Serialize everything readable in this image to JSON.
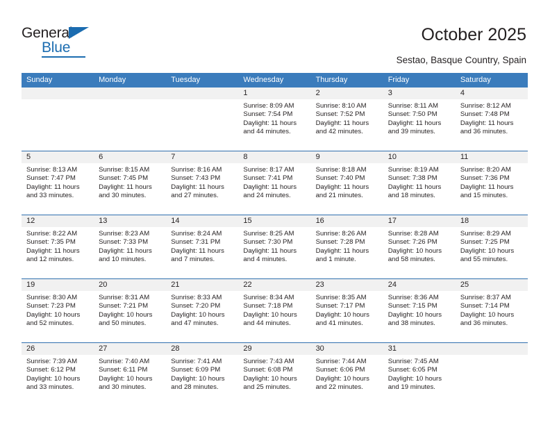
{
  "brand": {
    "name_part1": "General",
    "name_part2": "Blue",
    "accent_color": "#1b6cb0"
  },
  "header": {
    "title": "October 2025",
    "subtitle": "Sestao, Basque Country, Spain"
  },
  "calendar": {
    "header_bg": "#3b7cbc",
    "weekdays": [
      "Sunday",
      "Monday",
      "Tuesday",
      "Wednesday",
      "Thursday",
      "Friday",
      "Saturday"
    ],
    "labels": {
      "sunrise": "Sunrise:",
      "sunset": "Sunset:",
      "daylight": "Daylight:"
    },
    "weeks": [
      [
        {
          "day": "",
          "sunrise": "",
          "sunset": "",
          "daylight": "",
          "empty": true
        },
        {
          "day": "",
          "sunrise": "",
          "sunset": "",
          "daylight": "",
          "empty": true
        },
        {
          "day": "",
          "sunrise": "",
          "sunset": "",
          "daylight": "",
          "empty": true
        },
        {
          "day": "1",
          "sunrise": "Sunrise: 8:09 AM",
          "sunset": "Sunset: 7:54 PM",
          "daylight": "Daylight: 11 hours and 44 minutes."
        },
        {
          "day": "2",
          "sunrise": "Sunrise: 8:10 AM",
          "sunset": "Sunset: 7:52 PM",
          "daylight": "Daylight: 11 hours and 42 minutes."
        },
        {
          "day": "3",
          "sunrise": "Sunrise: 8:11 AM",
          "sunset": "Sunset: 7:50 PM",
          "daylight": "Daylight: 11 hours and 39 minutes."
        },
        {
          "day": "4",
          "sunrise": "Sunrise: 8:12 AM",
          "sunset": "Sunset: 7:48 PM",
          "daylight": "Daylight: 11 hours and 36 minutes."
        }
      ],
      [
        {
          "day": "5",
          "sunrise": "Sunrise: 8:13 AM",
          "sunset": "Sunset: 7:47 PM",
          "daylight": "Daylight: 11 hours and 33 minutes."
        },
        {
          "day": "6",
          "sunrise": "Sunrise: 8:15 AM",
          "sunset": "Sunset: 7:45 PM",
          "daylight": "Daylight: 11 hours and 30 minutes."
        },
        {
          "day": "7",
          "sunrise": "Sunrise: 8:16 AM",
          "sunset": "Sunset: 7:43 PM",
          "daylight": "Daylight: 11 hours and 27 minutes."
        },
        {
          "day": "8",
          "sunrise": "Sunrise: 8:17 AM",
          "sunset": "Sunset: 7:41 PM",
          "daylight": "Daylight: 11 hours and 24 minutes."
        },
        {
          "day": "9",
          "sunrise": "Sunrise: 8:18 AM",
          "sunset": "Sunset: 7:40 PM",
          "daylight": "Daylight: 11 hours and 21 minutes."
        },
        {
          "day": "10",
          "sunrise": "Sunrise: 8:19 AM",
          "sunset": "Sunset: 7:38 PM",
          "daylight": "Daylight: 11 hours and 18 minutes."
        },
        {
          "day": "11",
          "sunrise": "Sunrise: 8:20 AM",
          "sunset": "Sunset: 7:36 PM",
          "daylight": "Daylight: 11 hours and 15 minutes."
        }
      ],
      [
        {
          "day": "12",
          "sunrise": "Sunrise: 8:22 AM",
          "sunset": "Sunset: 7:35 PM",
          "daylight": "Daylight: 11 hours and 12 minutes."
        },
        {
          "day": "13",
          "sunrise": "Sunrise: 8:23 AM",
          "sunset": "Sunset: 7:33 PM",
          "daylight": "Daylight: 11 hours and 10 minutes."
        },
        {
          "day": "14",
          "sunrise": "Sunrise: 8:24 AM",
          "sunset": "Sunset: 7:31 PM",
          "daylight": "Daylight: 11 hours and 7 minutes."
        },
        {
          "day": "15",
          "sunrise": "Sunrise: 8:25 AM",
          "sunset": "Sunset: 7:30 PM",
          "daylight": "Daylight: 11 hours and 4 minutes."
        },
        {
          "day": "16",
          "sunrise": "Sunrise: 8:26 AM",
          "sunset": "Sunset: 7:28 PM",
          "daylight": "Daylight: 11 hours and 1 minute."
        },
        {
          "day": "17",
          "sunrise": "Sunrise: 8:28 AM",
          "sunset": "Sunset: 7:26 PM",
          "daylight": "Daylight: 10 hours and 58 minutes."
        },
        {
          "day": "18",
          "sunrise": "Sunrise: 8:29 AM",
          "sunset": "Sunset: 7:25 PM",
          "daylight": "Daylight: 10 hours and 55 minutes."
        }
      ],
      [
        {
          "day": "19",
          "sunrise": "Sunrise: 8:30 AM",
          "sunset": "Sunset: 7:23 PM",
          "daylight": "Daylight: 10 hours and 52 minutes."
        },
        {
          "day": "20",
          "sunrise": "Sunrise: 8:31 AM",
          "sunset": "Sunset: 7:21 PM",
          "daylight": "Daylight: 10 hours and 50 minutes."
        },
        {
          "day": "21",
          "sunrise": "Sunrise: 8:33 AM",
          "sunset": "Sunset: 7:20 PM",
          "daylight": "Daylight: 10 hours and 47 minutes."
        },
        {
          "day": "22",
          "sunrise": "Sunrise: 8:34 AM",
          "sunset": "Sunset: 7:18 PM",
          "daylight": "Daylight: 10 hours and 44 minutes."
        },
        {
          "day": "23",
          "sunrise": "Sunrise: 8:35 AM",
          "sunset": "Sunset: 7:17 PM",
          "daylight": "Daylight: 10 hours and 41 minutes."
        },
        {
          "day": "24",
          "sunrise": "Sunrise: 8:36 AM",
          "sunset": "Sunset: 7:15 PM",
          "daylight": "Daylight: 10 hours and 38 minutes."
        },
        {
          "day": "25",
          "sunrise": "Sunrise: 8:37 AM",
          "sunset": "Sunset: 7:14 PM",
          "daylight": "Daylight: 10 hours and 36 minutes."
        }
      ],
      [
        {
          "day": "26",
          "sunrise": "Sunrise: 7:39 AM",
          "sunset": "Sunset: 6:12 PM",
          "daylight": "Daylight: 10 hours and 33 minutes."
        },
        {
          "day": "27",
          "sunrise": "Sunrise: 7:40 AM",
          "sunset": "Sunset: 6:11 PM",
          "daylight": "Daylight: 10 hours and 30 minutes."
        },
        {
          "day": "28",
          "sunrise": "Sunrise: 7:41 AM",
          "sunset": "Sunset: 6:09 PM",
          "daylight": "Daylight: 10 hours and 28 minutes."
        },
        {
          "day": "29",
          "sunrise": "Sunrise: 7:43 AM",
          "sunset": "Sunset: 6:08 PM",
          "daylight": "Daylight: 10 hours and 25 minutes."
        },
        {
          "day": "30",
          "sunrise": "Sunrise: 7:44 AM",
          "sunset": "Sunset: 6:06 PM",
          "daylight": "Daylight: 10 hours and 22 minutes."
        },
        {
          "day": "31",
          "sunrise": "Sunrise: 7:45 AM",
          "sunset": "Sunset: 6:05 PM",
          "daylight": "Daylight: 10 hours and 19 minutes."
        },
        {
          "day": "",
          "sunrise": "",
          "sunset": "",
          "daylight": "",
          "empty": true
        }
      ]
    ]
  }
}
